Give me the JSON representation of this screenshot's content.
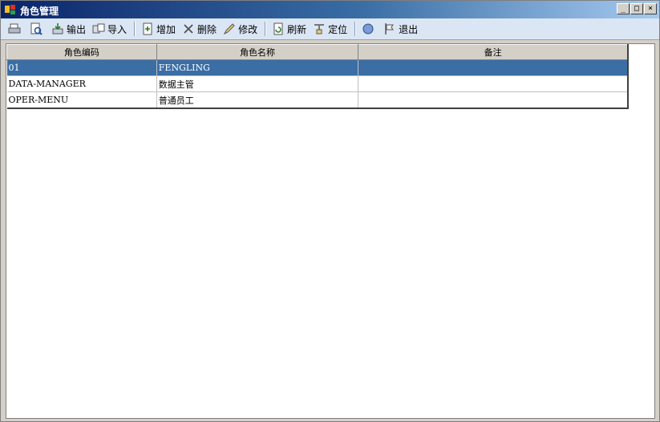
{
  "window": {
    "title": "角色管理",
    "controls": {
      "minimize": "_",
      "maximize": "□",
      "close": "×"
    }
  },
  "toolbar": {
    "buttons": [
      {
        "icon": "print-icon",
        "label": ""
      },
      {
        "icon": "print-preview-icon",
        "label": ""
      },
      {
        "icon": "export-icon",
        "label": "输出"
      },
      {
        "icon": "import-icon",
        "label": "导入"
      },
      {
        "icon": "add-icon",
        "label": "增加"
      },
      {
        "icon": "delete-icon",
        "label": "删除"
      },
      {
        "icon": "edit-icon",
        "label": "修改"
      },
      {
        "icon": "refresh-icon",
        "label": "刷新"
      },
      {
        "icon": "locate-icon",
        "label": "定位"
      },
      {
        "icon": "help-icon",
        "label": ""
      },
      {
        "icon": "exit-icon",
        "label": "退出"
      }
    ]
  },
  "grid": {
    "columns": [
      "角色编码",
      "角色名称",
      "备注"
    ],
    "rows": [
      {
        "code": "01",
        "name": "FENGLING",
        "note": "",
        "selected": true
      },
      {
        "code": "DATA-MANAGER",
        "name": "数据主管",
        "note": "",
        "selected": false
      },
      {
        "code": "OPER-MENU",
        "name": "普通员工",
        "note": "",
        "selected": false
      }
    ]
  },
  "colors": {
    "selection": "#3a6ea5",
    "toolbar_bg": "#dbe6f4",
    "title_start": "#0a246a"
  }
}
